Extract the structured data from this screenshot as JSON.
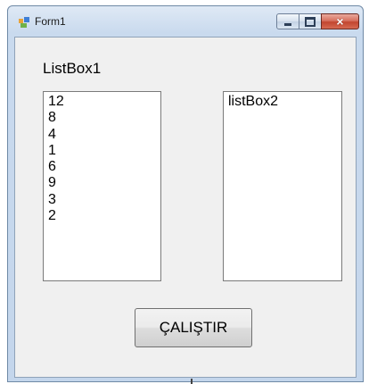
{
  "window": {
    "title": "Form1",
    "icon": "form-app-icon",
    "controls": {
      "minimize": "minimize-icon",
      "maximize": "maximize-icon",
      "close_glyph": "×"
    }
  },
  "form": {
    "label1": "ListBox1",
    "listbox1": {
      "items": [
        "12",
        "8",
        "4",
        "1",
        "6",
        "9",
        "3",
        "2"
      ]
    },
    "listbox2": {
      "items": [
        "listBox2"
      ]
    },
    "run_button": "ÇALIŞTIR"
  },
  "colors": {
    "client_bg": "#f0f0f0",
    "frame": "#c4d6ec",
    "close_button": "#c2452f"
  }
}
